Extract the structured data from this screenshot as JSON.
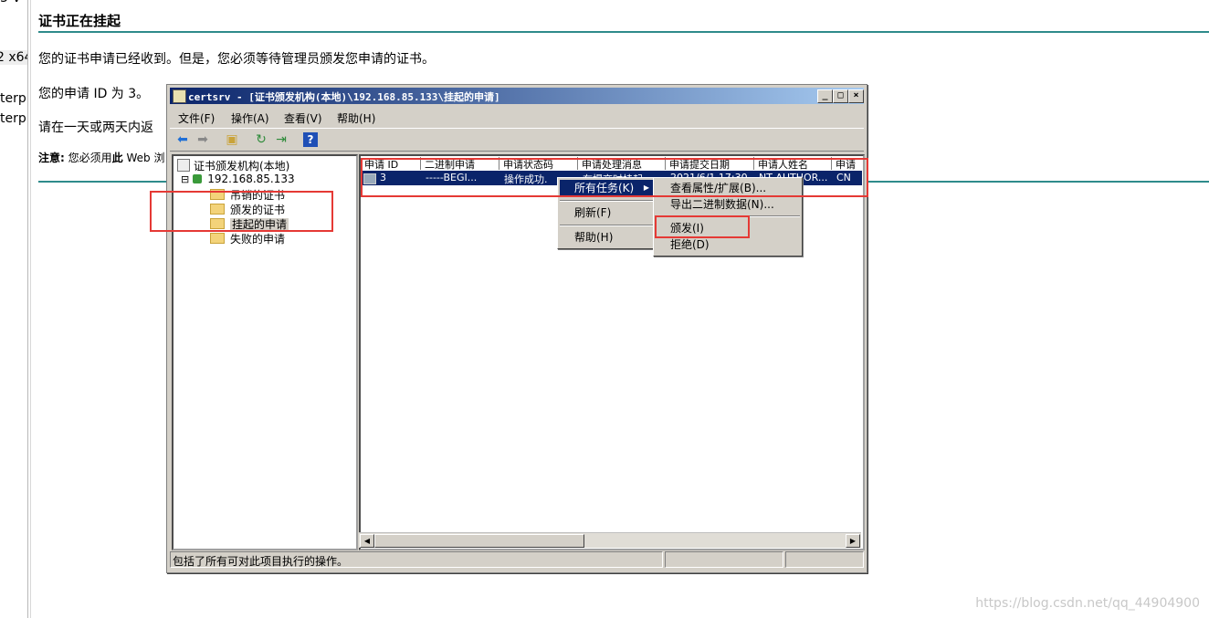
{
  "left_fragments": [
    "3 V",
    "2 x64",
    "terp",
    "terp"
  ],
  "page": {
    "title": "证书正在挂起",
    "para1": "您的证书申请已经收到。但是，您必须等待管理员颁发您申请的证书。",
    "para2": "您的申请 ID 为 3。",
    "para3": "请在一天或两天内返",
    "note_bold": "注意:",
    "note_text": " 您必须用",
    "note_bold2": "此",
    "note_text2": " Web 浏"
  },
  "window": {
    "title": "certsrv - [证书颁发机构(本地)\\192.168.85.133\\挂起的申请]",
    "menu": [
      "文件(F)",
      "操作(A)",
      "查看(V)",
      "帮助(H)"
    ],
    "controls": [
      "_",
      "□",
      "×"
    ],
    "toolbar_icons": [
      "back-icon",
      "forward-icon",
      "up-folder-icon",
      "refresh-icon",
      "export-icon",
      "help-icon"
    ],
    "status_text": "包括了所有可对此项目执行的操作。"
  },
  "tree": {
    "root": "证书颁发机构(本地)",
    "server": "192.168.85.133",
    "expander": "⊟",
    "folders": [
      "吊销的证书",
      "颁发的证书",
      "挂起的申请",
      "失败的申请"
    ],
    "selected_index": 2
  },
  "list": {
    "columns": [
      "申请 ID",
      "二进制申请",
      "申请状态码",
      "申请处理消息",
      "申请提交日期",
      "申请人姓名",
      "申请"
    ],
    "rows": [
      [
        "3",
        "-----BEGI...",
        "操作成功.",
        "在提交时挂起",
        "2021/6/1 17:30",
        "NT AUTHOR...",
        "CN"
      ]
    ]
  },
  "context_menu": {
    "items": [
      "所有任务(K)",
      "刷新(F)",
      "帮助(H)"
    ],
    "submenu_arrow": "▶"
  },
  "submenu": {
    "items": [
      "查看属性/扩展(B)...",
      "导出二进制数据(N)...",
      "颁发(I)",
      "拒绝(D)"
    ]
  },
  "watermark": "https://blog.csdn.net/qq_44904900"
}
